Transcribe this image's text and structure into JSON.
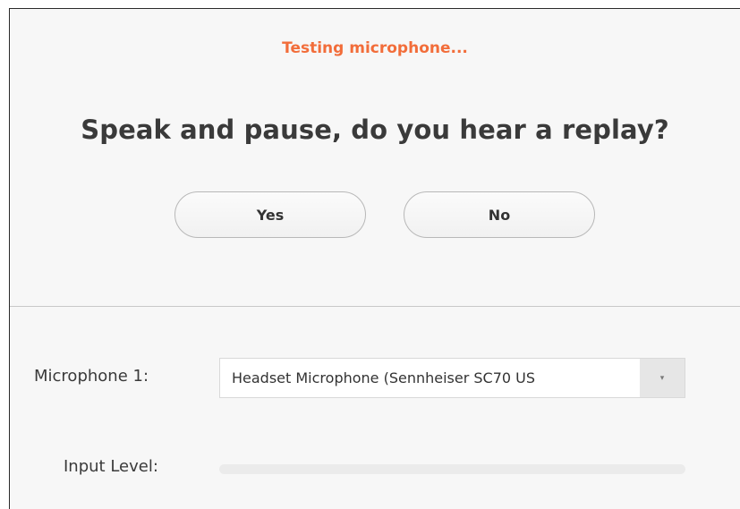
{
  "test": {
    "status": "Testing microphone...",
    "question": "Speak and pause, do you hear a replay?",
    "yes_label": "Yes",
    "no_label": "No"
  },
  "settings": {
    "microphone_label": "Microphone 1:",
    "microphone_value": "Headset Microphone (Sennheiser SC70 US",
    "input_level_label": "Input Level:",
    "input_level": 0
  },
  "colors": {
    "status": "#f26d3a",
    "text": "#3a3a3a"
  },
  "icons": {
    "dropdown": "chevron-down-icon"
  }
}
